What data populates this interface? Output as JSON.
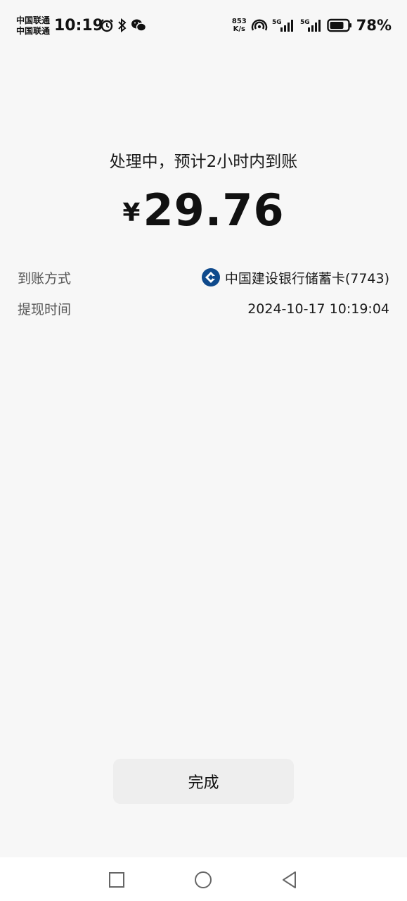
{
  "status_bar": {
    "carrier_1": "中国联通",
    "carrier_2": "中国联通",
    "time": "10:19",
    "speed_value": "853",
    "speed_unit": "K/s",
    "battery": "78%"
  },
  "result": {
    "message": "处理中，预计2小时内到账",
    "currency": "¥",
    "amount": "29.76"
  },
  "details": {
    "method_label": "到账方式",
    "method_value": "中国建设银行储蓄卡(7743)",
    "time_label": "提现时间",
    "time_value": "2024-10-17 10:19:04"
  },
  "actions": {
    "done_label": "完成"
  },
  "colors": {
    "background": "#f7f7f7",
    "button_bg": "#eeeeee",
    "ccb_blue": "#0f4a8c"
  }
}
